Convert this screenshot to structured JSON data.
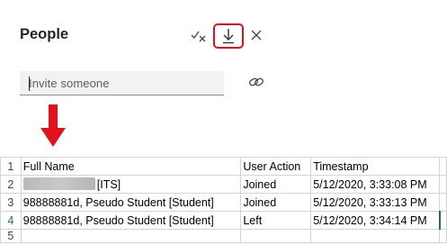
{
  "panel": {
    "title": "People",
    "invite_placeholder": "Invite someone",
    "icons": {
      "mute_all": "mute-all-icon",
      "download": "download-icon",
      "close": "close-icon",
      "share_link": "link-icon",
      "annotation": "red-down-arrow-icon"
    },
    "colors": {
      "highlight": "#e0121b"
    }
  },
  "sheet": {
    "row_numbers": [
      "1",
      "2",
      "3",
      "4",
      "5"
    ],
    "headers": [
      "Full Name",
      "User Action",
      "Timestamp"
    ],
    "rows": [
      {
        "name": "[ITS]",
        "action": "Joined",
        "timestamp": "5/12/2020, 3:33:08 PM"
      },
      {
        "name": "98888881d, Pseudo Student [Student]",
        "action": "Joined",
        "timestamp": "5/12/2020, 3:33:13 PM"
      },
      {
        "name": "98888881d, Pseudo Student [Student]",
        "action": "Left",
        "timestamp": "5/12/2020, 3:34:14 PM"
      }
    ]
  }
}
